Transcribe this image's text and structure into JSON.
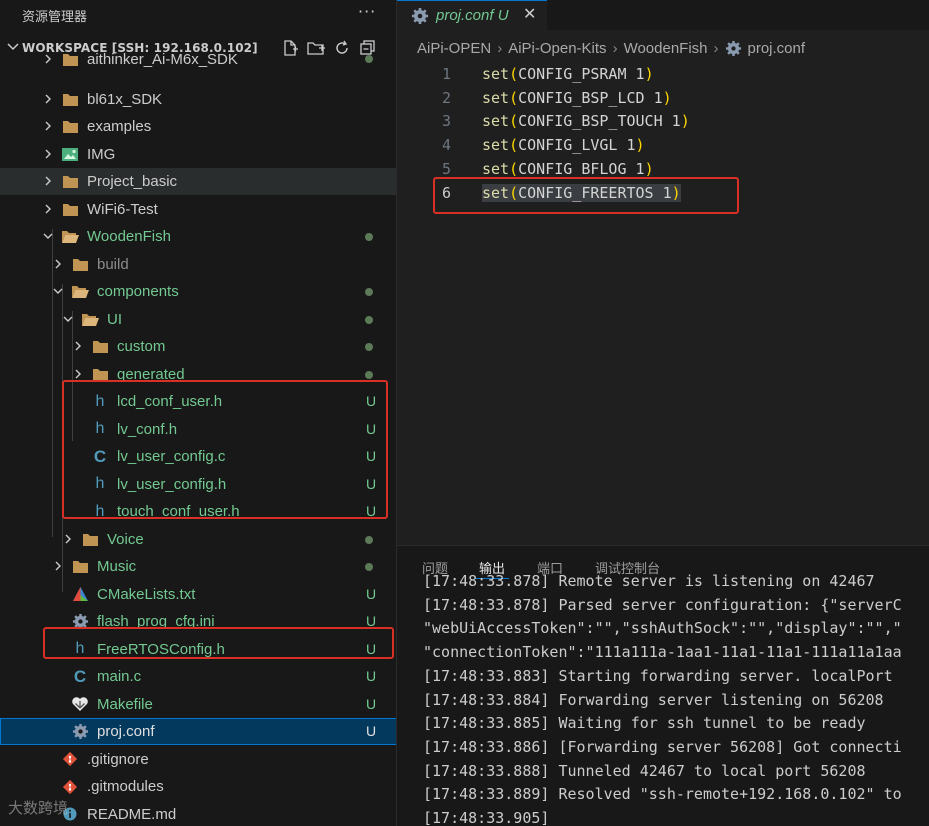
{
  "sidebar": {
    "title": "资源管理器",
    "more": "···",
    "workspace_title": "WORKSPACE [SSH: 192.168.0.102]",
    "items": [
      {
        "label": "aithinker_Ai-M6x_SDK",
        "icon": "folder-icon",
        "status": "dot"
      },
      {
        "label": "bl61x_SDK",
        "icon": "folder-icon",
        "status": ""
      },
      {
        "label": "examples",
        "icon": "folder-icon",
        "status": ""
      },
      {
        "label": "IMG",
        "icon": "image-folder-icon",
        "status": ""
      },
      {
        "label": "Project_basic",
        "icon": "folder-icon",
        "status": ""
      },
      {
        "label": "WiFi6-Test",
        "icon": "folder-icon",
        "status": ""
      },
      {
        "label": "WoodenFish",
        "icon": "folder-open-icon",
        "status": "dot"
      },
      {
        "label": "build",
        "icon": "folder-icon",
        "status": ""
      },
      {
        "label": "components",
        "icon": "folder-open-icon",
        "status": "dot"
      },
      {
        "label": "UI",
        "icon": "folder-open-icon",
        "status": "dot"
      },
      {
        "label": "custom",
        "icon": "folder-icon",
        "status": "dot"
      },
      {
        "label": "generated",
        "icon": "folder-icon",
        "status": "dot"
      },
      {
        "label": "lcd_conf_user.h",
        "icon": "h-file-icon",
        "status": "U"
      },
      {
        "label": "lv_conf.h",
        "icon": "h-file-icon",
        "status": "U"
      },
      {
        "label": "lv_user_config.c",
        "icon": "c-file-icon",
        "status": "U"
      },
      {
        "label": "lv_user_config.h",
        "icon": "h-file-icon",
        "status": "U"
      },
      {
        "label": "touch_conf_user.h",
        "icon": "h-file-icon",
        "status": "U"
      },
      {
        "label": "Voice",
        "icon": "folder-icon",
        "status": "dot"
      },
      {
        "label": "Music",
        "icon": "folder-icon",
        "status": "dot"
      },
      {
        "label": "CMakeLists.txt",
        "icon": "cmake-icon",
        "status": "U"
      },
      {
        "label": "flash_prog_cfg.ini",
        "icon": "gear-icon",
        "status": "U"
      },
      {
        "label": "FreeRTOSConfig.h",
        "icon": "h-file-icon",
        "status": "U"
      },
      {
        "label": "main.c",
        "icon": "c-file-icon",
        "status": "U"
      },
      {
        "label": "Makefile",
        "icon": "makefile-icon",
        "status": "U"
      },
      {
        "label": "proj.conf",
        "icon": "gear-icon",
        "status": "U"
      },
      {
        "label": ".gitignore",
        "icon": "git-icon",
        "status": ""
      },
      {
        "label": ".gitmodules",
        "icon": "git-icon",
        "status": ""
      },
      {
        "label": "README.md",
        "icon": "info-icon",
        "status": ""
      }
    ]
  },
  "watermark": "大数跨境",
  "editor": {
    "tab_name": "proj.conf",
    "tab_status": "U",
    "tab_close": "✕",
    "breadcrumb": [
      "AiPi-OPEN",
      "AiPi-Open-Kits",
      "WoodenFish",
      "proj.conf"
    ],
    "lines": [
      {
        "num": "1",
        "fn": "set",
        "arg": "CONFIG_PSRAM 1"
      },
      {
        "num": "2",
        "fn": "set",
        "arg": "CONFIG_BSP_LCD 1"
      },
      {
        "num": "3",
        "fn": "set",
        "arg": "CONFIG_BSP_TOUCH 1"
      },
      {
        "num": "4",
        "fn": "set",
        "arg": "CONFIG_LVGL 1"
      },
      {
        "num": "5",
        "fn": "set",
        "arg": "CONFIG_BFLOG 1"
      },
      {
        "num": "6",
        "fn": "set",
        "arg": "CONFIG_FREERTOS 1"
      }
    ]
  },
  "panel": {
    "tabs": [
      "问题",
      "输出",
      "端口",
      "调试控制台"
    ],
    "log": [
      "[17:48:33.878] Remote server is listening on 42467",
      "[17:48:33.878] Parsed server configuration: {\"serverC",
      "\"webUiAccessToken\":\"\",\"sshAuthSock\":\"\",\"display\":\"\",\"",
      "\"connectionToken\":\"111a111a-1aa1-11a1-11a1-111a11a1aa",
      "[17:48:33.883] Starting forwarding server. localPort",
      "[17:48:33.884] Forwarding server listening on 56208",
      "[17:48:33.885] Waiting for ssh tunnel to be ready",
      "[17:48:33.886] [Forwarding server 56208] Got connecti",
      "[17:48:33.888] Tunneled 42467 to local port 56208",
      "[17:48:33.889] Resolved \"ssh-remote+192.168.0.102\" to",
      "[17:48:33.905]"
    ]
  },
  "colors": {
    "accent": "#0078d4",
    "untracked": "#73c991",
    "highlight_box": "#d93025"
  }
}
